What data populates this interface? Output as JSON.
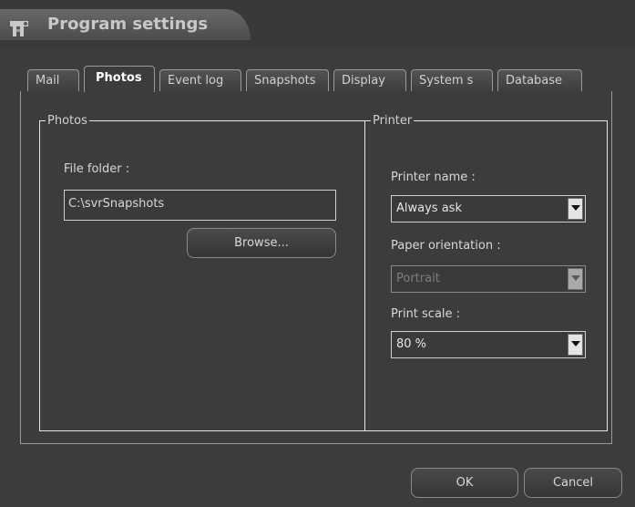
{
  "window": {
    "title": "Program settings",
    "icon": "camera-settings-icon"
  },
  "tabs": [
    {
      "label": "Mail"
    },
    {
      "label": "Photos"
    },
    {
      "label": "Event log"
    },
    {
      "label": "Snapshots"
    },
    {
      "label": "Display"
    },
    {
      "label": "System s"
    },
    {
      "label": "Database"
    }
  ],
  "active_tab": "Photos",
  "photos": {
    "legend": "Photos",
    "file_folder_label": "File folder :",
    "file_folder_value": "C:\\svrSnapshots",
    "browse_label": "Browse..."
  },
  "printer": {
    "legend": "Printer",
    "printer_name_label": "Printer name :",
    "printer_name_value": "Always ask",
    "paper_orientation_label": "Paper orientation :",
    "paper_orientation_value": "Portrait",
    "print_scale_label": "Print scale :",
    "print_scale_value": "80 %"
  },
  "footer": {
    "ok_label": "OK",
    "cancel_label": "Cancel"
  }
}
